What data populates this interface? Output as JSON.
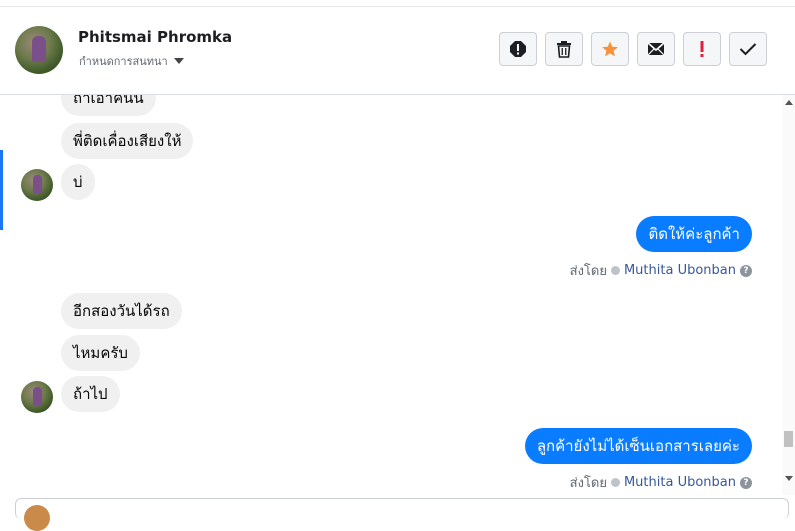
{
  "header": {
    "name": "Phitsmai Phromka",
    "subtitle": "กำหนดการสนทนา"
  },
  "toolbar": [
    {
      "icon": "report-icon",
      "color": "#1c1e21"
    },
    {
      "icon": "trash-icon",
      "color": "#1c1e21"
    },
    {
      "icon": "star-icon",
      "color": "#f7923b"
    },
    {
      "icon": "mail-icon",
      "color": "#1c1e21"
    },
    {
      "icon": "exclamation-icon",
      "color": "#e41e3f"
    },
    {
      "icon": "check-icon",
      "color": "#1c1e21"
    }
  ],
  "messages": [
    {
      "text": "ถ้าเอาคนน",
      "direction": "in"
    },
    {
      "text": "พี่ติดเคื่องเสียงให้",
      "direction": "in"
    },
    {
      "text": "บ่",
      "direction": "in"
    },
    {
      "text": "ติดให้ค่ะลูกค้า",
      "direction": "out"
    },
    {
      "text": "อีกสองวันได้รถ",
      "direction": "in"
    },
    {
      "text": "ไหมครับ",
      "direction": "in"
    },
    {
      "text": "ถ้าไป",
      "direction": "in"
    },
    {
      "text": "ลูกค้ายังไม่ได้เซ็นเอกสารเลยค่ะ",
      "direction": "out"
    }
  ],
  "sent_by": {
    "prefix": "ส่งโดย",
    "agent": "Muthita Ubonban"
  },
  "colors": {
    "outgoing_bubble": "#0a7cff",
    "incoming_bubble": "#f0f0f0",
    "accent": "#1877f2"
  }
}
